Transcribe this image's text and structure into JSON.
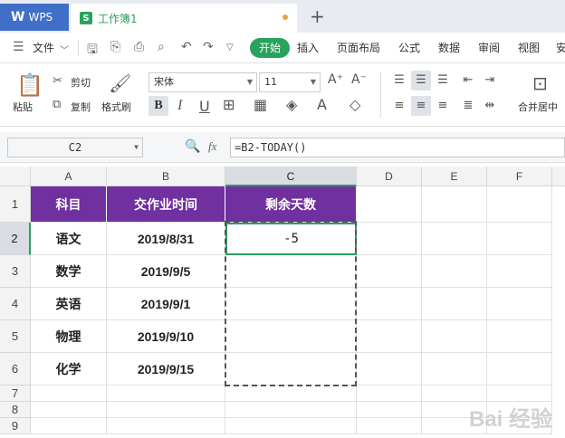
{
  "titlebar": {
    "app_name": "WPS",
    "doc_tab": "工作簿1",
    "new_tab": "+"
  },
  "menubar": {
    "file": "文件",
    "tabs": [
      "开始",
      "插入",
      "页面布局",
      "公式",
      "数据",
      "审阅",
      "视图",
      "安"
    ]
  },
  "ribbon": {
    "paste": "粘贴",
    "cut": "剪切",
    "copy": "复制",
    "format_painter": "格式刷",
    "font_name": "宋体",
    "font_size": "11",
    "merge_center": "合并居中"
  },
  "formulabar": {
    "cell_ref": "C2",
    "fx": "fx",
    "formula": "=B2-TODAY()"
  },
  "grid": {
    "columns": [
      "A",
      "B",
      "C",
      "D",
      "E",
      "F"
    ],
    "rows": [
      "1",
      "2",
      "3",
      "4",
      "5",
      "6",
      "7",
      "8",
      "9"
    ],
    "header": [
      "科目",
      "交作业时间",
      "剩余天数"
    ],
    "data": [
      [
        "语文",
        "2019/8/31",
        "-5"
      ],
      [
        "数学",
        "2019/9/5",
        ""
      ],
      [
        "英语",
        "2019/9/1",
        ""
      ],
      [
        "物理",
        "2019/9/10",
        ""
      ],
      [
        "化学",
        "2019/9/15",
        ""
      ]
    ],
    "watermark": "Bai 经验"
  },
  "colors": {
    "header_fill": "#7030a0",
    "accent": "#27a35c",
    "wps_blue": "#3f6fc6"
  }
}
